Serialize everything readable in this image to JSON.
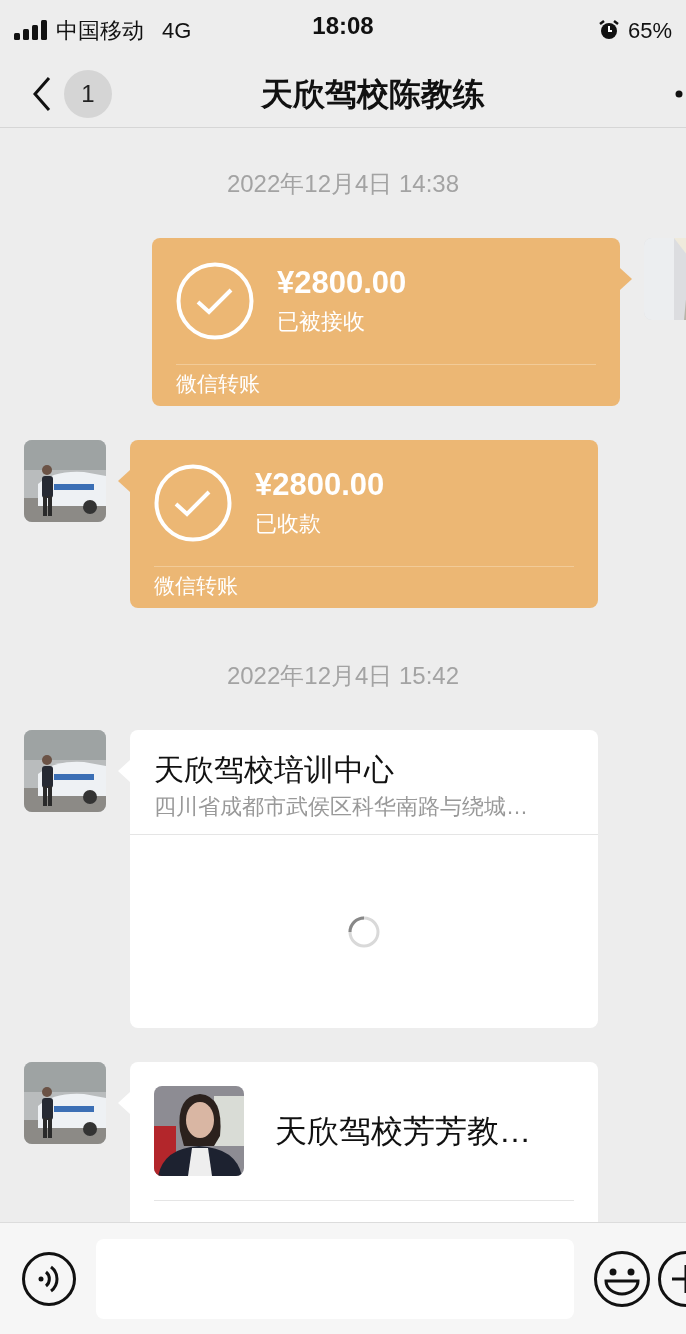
{
  "status_bar": {
    "carrier": "中国移动",
    "network": "4G",
    "time": "18:08",
    "battery": "65%"
  },
  "nav": {
    "unread_count": "1",
    "title": "天欣驾校陈教练"
  },
  "messages": [
    {
      "kind": "timestamp",
      "text": "2022年12月4日 14:38"
    },
    {
      "kind": "transfer",
      "outgoing": true,
      "amount": "¥2800.00",
      "status": "已被接收",
      "footer": "微信转账"
    },
    {
      "kind": "transfer",
      "outgoing": false,
      "amount": "¥2800.00",
      "status": "已收款",
      "footer": "微信转账"
    },
    {
      "kind": "timestamp",
      "text": "2022年12月4日 15:42"
    },
    {
      "kind": "location",
      "outgoing": false,
      "title": "天欣驾校培训中心",
      "address": "四川省成都市武侯区科华南路与绕城…"
    },
    {
      "kind": "contact_card",
      "outgoing": false,
      "name": "天欣驾校芳芳教…"
    }
  ]
}
